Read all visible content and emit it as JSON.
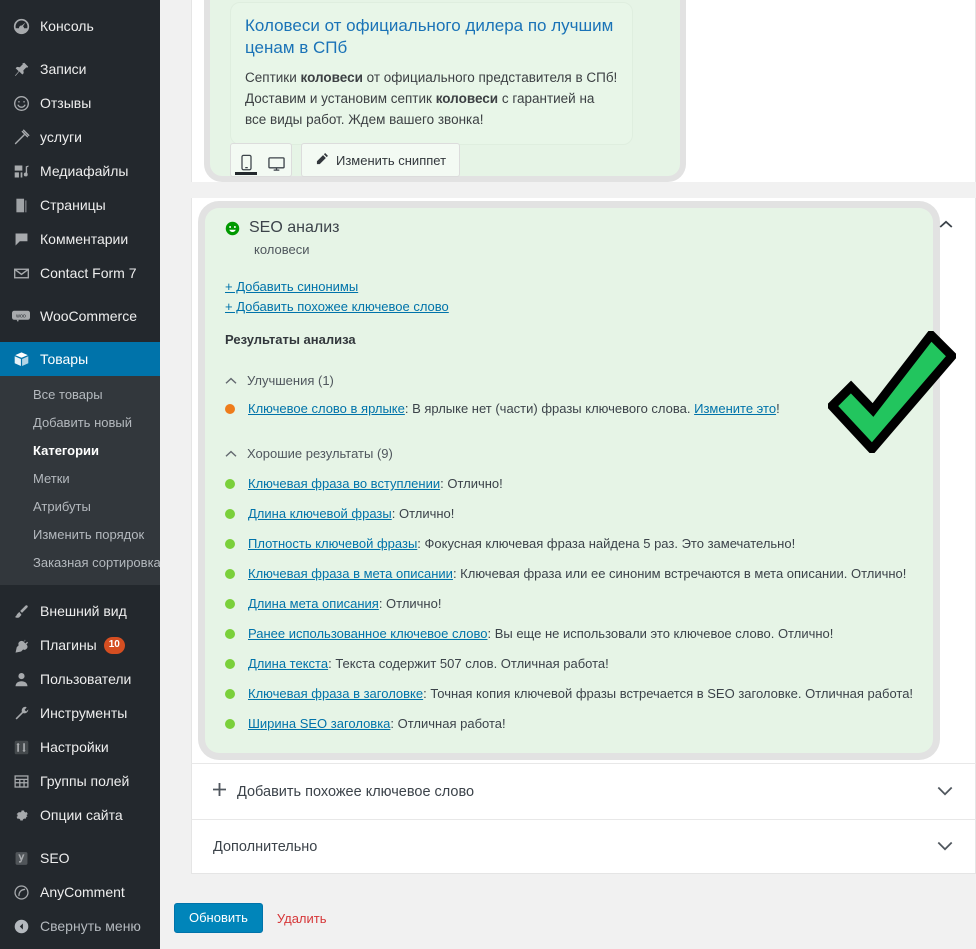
{
  "sidebar": {
    "items": [
      {
        "label": "Консоль",
        "icon": "dashboard-icon",
        "name": "sidebar-item-dashboard"
      },
      {
        "label": "Записи",
        "icon": "pin-icon",
        "name": "sidebar-item-posts"
      },
      {
        "label": "Отзывы",
        "icon": "smiley-icon",
        "name": "sidebar-item-reviews"
      },
      {
        "label": "услуги",
        "icon": "hammer-icon",
        "name": "sidebar-item-services"
      },
      {
        "label": "Медиафайлы",
        "icon": "media-icon",
        "name": "sidebar-item-media"
      },
      {
        "label": "Страницы",
        "icon": "page-icon",
        "name": "sidebar-item-pages"
      },
      {
        "label": "Комментарии",
        "icon": "comment-icon",
        "name": "sidebar-item-comments"
      },
      {
        "label": "Contact Form 7",
        "icon": "envelope-icon",
        "name": "sidebar-item-contact-form-7"
      },
      {
        "label": "WooCommerce",
        "icon": "woo-icon",
        "name": "sidebar-item-woocommerce"
      }
    ],
    "current": {
      "label": "Товары",
      "icon": "product-box-icon",
      "name": "sidebar-item-products"
    },
    "submenu": [
      {
        "label": "Все товары",
        "active": false
      },
      {
        "label": "Добавить новый",
        "active": false
      },
      {
        "label": "Категории",
        "active": true
      },
      {
        "label": "Метки",
        "active": false
      },
      {
        "label": "Атрибуты",
        "active": false
      },
      {
        "label": "Изменить порядок",
        "active": false
      },
      {
        "label": "Заказная сортировка",
        "active": false
      }
    ],
    "items_after": [
      {
        "label": "Внешний вид",
        "icon": "brush-icon",
        "name": "sidebar-item-appearance"
      },
      {
        "label": "Плагины",
        "icon": "plugin-icon",
        "badge": "10",
        "name": "sidebar-item-plugins"
      },
      {
        "label": "Пользователи",
        "icon": "user-icon",
        "name": "sidebar-item-users"
      },
      {
        "label": "Инструменты",
        "icon": "wrench-icon",
        "name": "sidebar-item-tools"
      },
      {
        "label": "Настройки",
        "icon": "sliders-icon",
        "name": "sidebar-item-settings"
      },
      {
        "label": "Группы полей",
        "icon": "table-icon",
        "name": "sidebar-item-field-groups"
      },
      {
        "label": "Опции сайта",
        "icon": "gear-icon",
        "name": "sidebar-item-site-options"
      }
    ],
    "items_plugins": [
      {
        "label": "SEO",
        "icon": "yoast-icon",
        "name": "sidebar-item-seo"
      },
      {
        "label": "AnyComment",
        "icon": "anycomment-icon",
        "name": "sidebar-item-anycomment"
      }
    ],
    "collapse": {
      "label": "Свернуть меню",
      "icon": "collapse-arrow-icon"
    }
  },
  "snippet": {
    "title": "Коловеси от официального дилера по лучшим ценам в СПб",
    "description_parts": [
      {
        "text": "Септики ",
        "bold": false
      },
      {
        "text": "коловеси",
        "bold": true
      },
      {
        "text": " от официального представителя в СПб! Доставим и установим септик ",
        "bold": false
      },
      {
        "text": "коловеси",
        "bold": true
      },
      {
        "text": " с гарантией на все виды работ. Ждем вашего звонка!",
        "bold": false
      }
    ],
    "mobile_button": "mobile-preview-icon",
    "desktop_button": "desktop-preview-icon",
    "active_preview": "mobile",
    "edit_snippet_label": "Изменить сниппет"
  },
  "seo_analysis": {
    "title": "SEO анализ",
    "score_icon": "green-smiley-icon",
    "keyword": "коловеси",
    "add_synonyms_label": "+ Добавить синонимы",
    "add_related_keyword_label": "+ Добавить похожее ключевое слово",
    "results_heading": "Результаты анализа",
    "groups": [
      {
        "name": "improvements",
        "label": "Улучшения (1)",
        "expanded": true,
        "dot_color": "#ee7c1b",
        "items": [
          {
            "link": "Ключевое слово в ярлыке",
            "rest": ": В ярлыке нет (части) фразы ключевого слова. ",
            "trailing_link": "Измените это",
            "trailing_text": "!"
          }
        ]
      },
      {
        "name": "good-results",
        "label": "Хорошие результаты (9)",
        "expanded": true,
        "dot_color": "#7ad03a",
        "items": [
          {
            "link": "Ключевая фраза во вступлении",
            "rest": ": Отлично!"
          },
          {
            "link": "Длина ключевой фразы",
            "rest": ": Отлично!"
          },
          {
            "link": "Плотность ключевой фразы",
            "rest": ": Фокусная ключевая фраза найдена 5 раз. Это замечательно!"
          },
          {
            "link": "Ключевая фраза в мета описании",
            "rest": ": Ключевая фраза или ее синоним встречаются в мета описании. Отлично!"
          },
          {
            "link": "Длина мета описания",
            "rest": ": Отлично!"
          },
          {
            "link": "Ранее использованное ключевое слово",
            "rest": ": Вы еще не использовали это ключевое слово. Отлично!"
          },
          {
            "link": "Длина текста",
            "rest": ": Текста содержит 507 слов. Отличная работа!"
          },
          {
            "link": "Ключевая фраза в заголовке",
            "rest": ": Точная копия ключевой фразы встречается в SEO заголовке. Отличная работа!"
          },
          {
            "link": "Ширина SEO заголовка",
            "rest": ": Отличная работа!"
          }
        ]
      }
    ]
  },
  "panels": [
    {
      "label": "Добавить похожее ключевое слово",
      "icon": "plus-icon",
      "expanded": false
    },
    {
      "label": "Дополнительно",
      "icon": "",
      "expanded": false
    }
  ],
  "actions": {
    "update_label": "Обновить",
    "delete_label": "Удалить"
  },
  "overlay": {
    "checkmark_icon": "green-checkmark-annotation",
    "fill": "#22c55e",
    "stroke": "#000000"
  },
  "colors": {
    "admin_bg": "#23282d",
    "accent": "#0073aa",
    "yoast_highlight_bg": "#e6f4e6",
    "good_green": "#7ad03a",
    "improvement_orange": "#ee7c1b",
    "delete_red": "#d63638",
    "badge_orange": "#d54e21"
  }
}
